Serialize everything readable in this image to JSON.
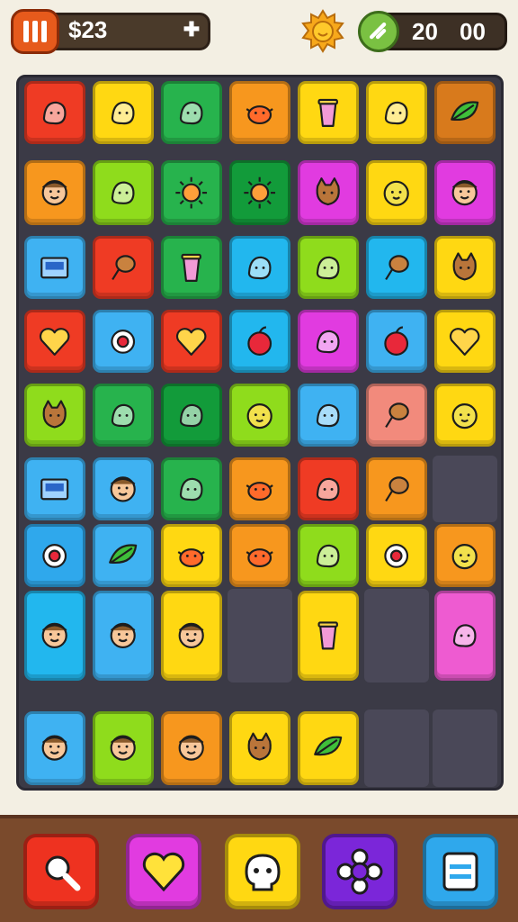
{
  "header": {
    "money": "$23",
    "time_hours": "20",
    "time_minutes": "00",
    "icons": [
      "pause-icon",
      "plus-icon",
      "sun-icon",
      "clock-icon"
    ]
  },
  "colors": {
    "red": "#ef3b24",
    "yellow": "#ffd812",
    "green": "#27b34d",
    "orange": "#f7971e",
    "lime": "#8fdc1c",
    "darkgreen": "#129b3a",
    "magenta": "#e13be0",
    "cyan": "#22b7ee",
    "skyblue": "#3fb2f2",
    "salmon": "#f28a7c",
    "brown": "#d87a1c",
    "pink": "#ee5bd1",
    "purple": "#7b26d9",
    "blue": "#2fa8ec"
  },
  "board": {
    "rows": [
      [
        "red",
        "yellow",
        "green",
        "orange",
        "yellow",
        "yellow",
        "brown"
      ],
      [
        "orange",
        "lime",
        "green",
        "darkgreen",
        "magenta",
        "yellow",
        "magenta"
      ],
      [
        "skyblue",
        "red",
        "green",
        "cyan",
        "lime",
        "cyan",
        "yellow"
      ],
      [
        "red",
        "skyblue",
        "red",
        "cyan",
        "magenta",
        "skyblue",
        "yellow"
      ],
      [
        "lime",
        "green",
        "darkgreen",
        "lime",
        "skyblue",
        "salmon",
        "yellow"
      ],
      [
        "skyblue",
        "skyblue",
        "green",
        "orange",
        "red",
        "orange",
        "empty"
      ],
      [
        "blue",
        "skyblue",
        "yellow",
        "orange",
        "lime",
        "yellow",
        "orange"
      ],
      [
        "cyan",
        "skyblue",
        "yellow",
        "empty",
        "yellow",
        "empty",
        "pink"
      ],
      [
        "skyblue",
        "lime",
        "orange",
        "yellow",
        "yellow",
        "empty",
        "empty"
      ]
    ],
    "icons": [
      [
        "drop-icon",
        "caterpillar-icon",
        "bag-icon",
        "fish-icon",
        "glass-icon",
        "moon-icon",
        "leaf-icon"
      ],
      [
        "face-icon",
        "cheese-icon",
        "sun-icon",
        "sun-icon",
        "cat-face-icon",
        "blob-face-icon",
        "face-icon"
      ],
      [
        "screen-icon",
        "bread-icon",
        "cup-icon",
        "flower-icon",
        "pencil-icon",
        "drumstick-icon",
        "cat-icon"
      ],
      [
        "heart-icon",
        "target-icon",
        "heart-icon",
        "apple-icon",
        "brush-icon",
        "apple-icon",
        "heart-icon"
      ],
      [
        "fox-icon",
        "shark-icon",
        "worm-icon",
        "ball-icon",
        "dove-icon",
        "cone-icon",
        "blob-face-icon"
      ],
      [
        "map-icon",
        "face-icon",
        "microphone-icon",
        "crab-icon",
        "pineapple-icon",
        "icecream-icon",
        "melon-icon"
      ],
      [
        "planet-icon",
        "leaf-icon",
        "chick-icon",
        "bird-icon",
        "berry-icon",
        "orbit-icon",
        "cloud-icon"
      ],
      [
        "face-icon",
        "face-icon",
        "face-icon",
        "face-icon",
        "bottle-icon",
        "cup-icon",
        "jar-icon"
      ],
      [
        "face-icon",
        "face-icon",
        "face-icon",
        "dog-icon",
        "leaf-icon",
        "crab-icon",
        "painting-icon"
      ]
    ]
  },
  "powerups": [
    {
      "icon": "magnifier-icon",
      "color": "#ee3220"
    },
    {
      "icon": "heart-icon",
      "color": "#e13be0"
    },
    {
      "icon": "skull-icon",
      "color": "#ffd812"
    },
    {
      "icon": "flower-icon",
      "color": "#7b26d9"
    },
    {
      "icon": "menu-icon",
      "color": "#2fa8ec"
    }
  ]
}
